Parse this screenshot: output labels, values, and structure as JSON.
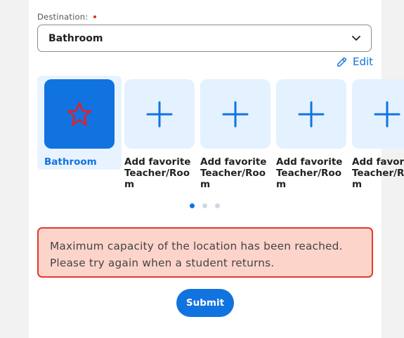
{
  "destination": {
    "label": "Destination:",
    "selected_value": "Bathroom"
  },
  "edit_link": {
    "label": "Edit",
    "icon": "pencil-icon"
  },
  "favorites": [
    {
      "label": "Bathroom",
      "icon": "star-icon",
      "selected": true
    },
    {
      "label": "Add favorite Teacher/Room",
      "icon": "plus-icon",
      "selected": false
    },
    {
      "label": "Add favorite Teacher/Room",
      "icon": "plus-icon",
      "selected": false
    },
    {
      "label": "Add favorite Teacher/Room",
      "icon": "plus-icon",
      "selected": false
    },
    {
      "label": "Add favorite Teacher/Room",
      "icon": "plus-icon",
      "selected": false
    }
  ],
  "pagination": {
    "pages": 3,
    "active": 1
  },
  "alert": {
    "message": "Maximum capacity of the location has been reached. Please try again when a student returns."
  },
  "submit": {
    "label": "Submit"
  },
  "colors": {
    "accent": "#1173e0",
    "error_border": "#e03b2f",
    "error_bg": "#fcd4ca",
    "star": "#e0202e"
  }
}
